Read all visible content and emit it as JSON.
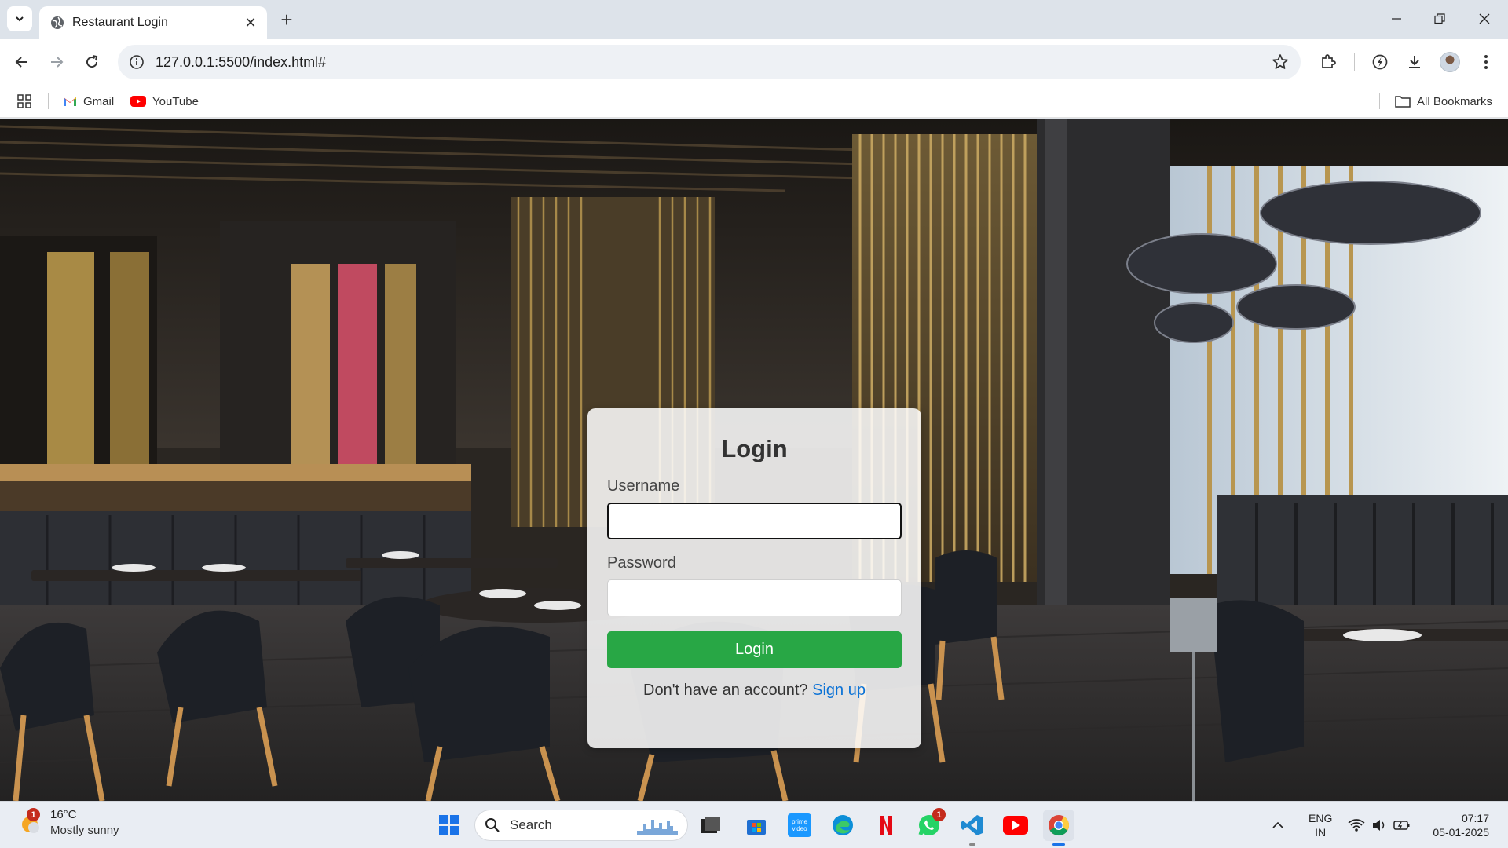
{
  "browser": {
    "tab": {
      "title": "Restaurant Login"
    },
    "address": {
      "url": "127.0.0.1:5500/index.html#"
    },
    "bookmarks": [
      {
        "label": "Gmail",
        "icon": "gmail-icon"
      },
      {
        "label": "YouTube",
        "icon": "youtube-icon"
      }
    ],
    "all_bookmarks_label": "All Bookmarks"
  },
  "login": {
    "title": "Login",
    "username_label": "Username",
    "username_value": "",
    "password_label": "Password",
    "password_value": "",
    "button_label": "Login",
    "signup_prompt": "Don't have an account?",
    "signup_link": "Sign up",
    "button_color": "#28a745",
    "link_color": "#0b72d6"
  },
  "taskbar": {
    "weather": {
      "temp": "16°C",
      "condition": "Mostly sunny",
      "badge": "1"
    },
    "search_label": "Search",
    "whatsapp_badge": "1",
    "language": {
      "line1": "ENG",
      "line2": "IN"
    },
    "clock": {
      "time": "07:17",
      "date": "05-01-2025"
    }
  }
}
